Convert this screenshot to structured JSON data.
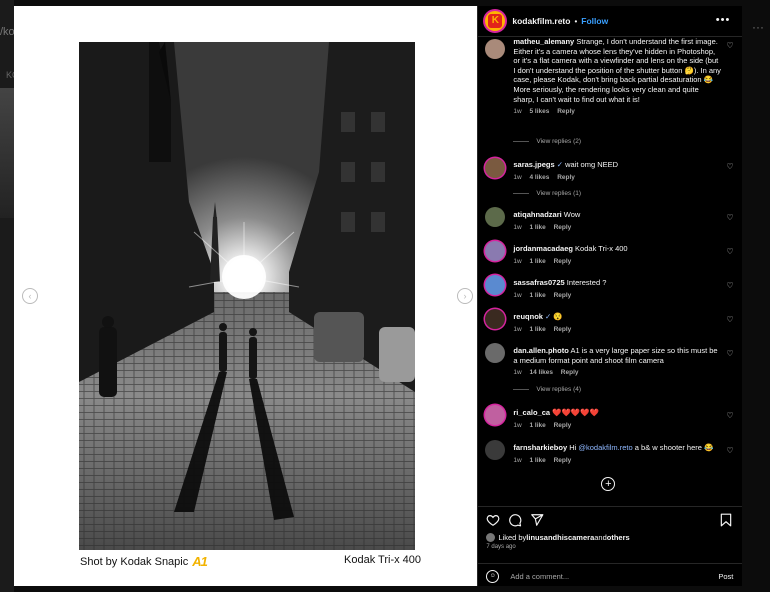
{
  "background": {
    "left_text": "/koo",
    "left_text2": "KO",
    "more_icon": "more-horizontal-icon"
  },
  "post": {
    "account": "kodakfilm.reto",
    "separator": "•",
    "follow_label": "Follow",
    "more_label": "•••",
    "caption_left_prefix": "Shot by Kodak Snapic",
    "caption_left_ai": "A1",
    "caption_right": "Kodak Tri-x 400",
    "prev_arrow": "‹",
    "next_arrow": "›"
  },
  "comments": [
    {
      "user": "matheu_alemany",
      "text": " Strange, I don't understand the first image. Either it's a camera whose lens they've hidden in Photoshop, or it's a flat camera with a viewfinder and lens on the side (but I don't understand the position of the shutter button 🤔). In any case, please Kodak, don't bring back partial desaturation 😂 More seriously, the rendering looks very clean and quite sharp, I can't wait to find out what it is!",
      "time": "1w",
      "likes": "5 likes",
      "reply": "Reply",
      "view_replies": "View replies (2)"
    },
    {
      "user": "saras.jpegs",
      "verified": "✓",
      "text": " wait omg NEED",
      "time": "1w",
      "likes": "4 likes",
      "reply": "Reply",
      "view_replies": "View replies (1)"
    },
    {
      "user": "atiqahnadzari",
      "text": " Wow",
      "time": "1w",
      "likes": "1 like",
      "reply": "Reply"
    },
    {
      "user": "jordanmacadaeg",
      "text": " Kodak Tri-x 400",
      "time": "1w",
      "likes": "1 like",
      "reply": "Reply"
    },
    {
      "user": "sassafras0725",
      "text": " Interested ?",
      "time": "1w",
      "likes": "1 like",
      "reply": "Reply"
    },
    {
      "user": "reuqnok",
      "verified": "✓",
      "text": " 😯",
      "time": "1w",
      "likes": "1 like",
      "reply": "Reply"
    },
    {
      "user": "dan.allen.photo",
      "text": " A1 is a very large paper size so this must be a medium format point and shoot film camera",
      "time": "1w",
      "likes": "14 likes",
      "reply": "Reply",
      "view_replies": "View replies (4)"
    },
    {
      "user": "ri_calo_ca",
      "text": " ❤️❤️❤️❤️❤️",
      "time": "1w",
      "likes": "1 like",
      "reply": "Reply"
    },
    {
      "user": "farnsharkieboy",
      "text_before": " Hi ",
      "mention": "@kodakfilm.reto",
      "text_after": " a b& w shooter here 😂",
      "time": "1w",
      "likes": "1 like",
      "reply": "Reply"
    }
  ],
  "load_more": "+",
  "actions": {
    "liked_by_prefix": "Liked by ",
    "liked_by_user": "linusandhiscamera",
    "liked_by_mid": " and ",
    "liked_by_others": "others",
    "ago": "7 days ago"
  },
  "add_comment": {
    "emoji": "☺",
    "placeholder": "Add a comment...",
    "post_label": "Post"
  },
  "colors": {
    "accent": "#3aa0ff",
    "panel_bg": "#000000",
    "kodak_yellow": "#ffb300",
    "kodak_red": "#e2231a"
  }
}
